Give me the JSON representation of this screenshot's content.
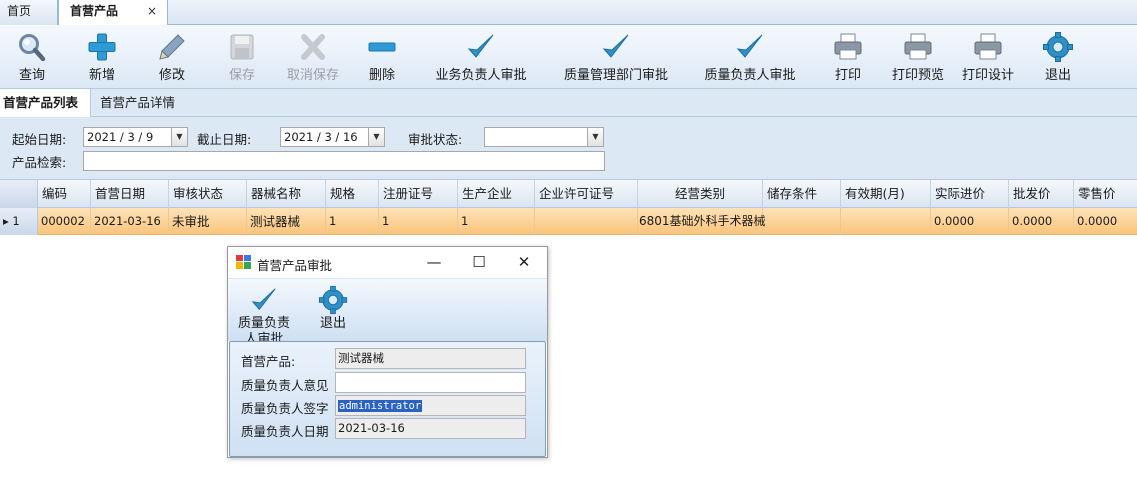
{
  "doc_tabs": {
    "home": "首页",
    "active": "首营产品",
    "close": "×"
  },
  "toolbar": {
    "query": "查询",
    "add": "新增",
    "edit": "修改",
    "save": "保存",
    "cancel_save": "取消保存",
    "delete": "删除",
    "biz_approve": "业务负责人审批",
    "qa_dept_approve": "质量管理部门审批",
    "qa_owner_approve": "质量负责人审批",
    "print": "打印",
    "print_preview": "打印预览",
    "print_design": "打印设计",
    "exit": "退出"
  },
  "sub_tabs": {
    "list": "首营产品列表",
    "detail": "首营产品详情"
  },
  "filter": {
    "start_label": "起始日期:",
    "start_value": "2021 / 3 / 9",
    "end_label": "截止日期:",
    "end_value": "2021 / 3 / 16",
    "status_label": "审批状态:",
    "status_value": "",
    "search_label": "产品检索:",
    "search_value": ""
  },
  "grid": {
    "columns": [
      "编码",
      "首营日期",
      "审核状态",
      "器械名称",
      "规格",
      "注册证号",
      "生产企业",
      "企业许可证号",
      "经营类别",
      "储存条件",
      "有效期(月)",
      "实际进价",
      "批发价",
      "零售价"
    ],
    "row": {
      "indicator": "▸ 1",
      "cells": [
        "000002",
        "2021-03-16",
        "未审批",
        "测试器械",
        "1",
        "1",
        "1",
        "",
        "6801基础外科手术器械",
        "",
        "",
        "0.0000",
        "0.0000",
        "0.0000"
      ]
    }
  },
  "dialog": {
    "title": "首营产品审批",
    "minimize": "—",
    "maximize": "☐",
    "close": "✕",
    "btn_approve": "质量负责人审批",
    "btn_exit": "退出",
    "product_label": "首营产品:",
    "product_value": "测试器械",
    "opinion_label": "质量负责人意见",
    "opinion_value": "",
    "signature_label": "质量负责人签字",
    "signature_value": "administrator",
    "date_label": "质量负责人日期",
    "date_value": "2021-03-16"
  },
  "colors": {
    "accent": "#2c7fb8",
    "selected_row": "#fbc57d",
    "panel": "#dde8f5"
  }
}
